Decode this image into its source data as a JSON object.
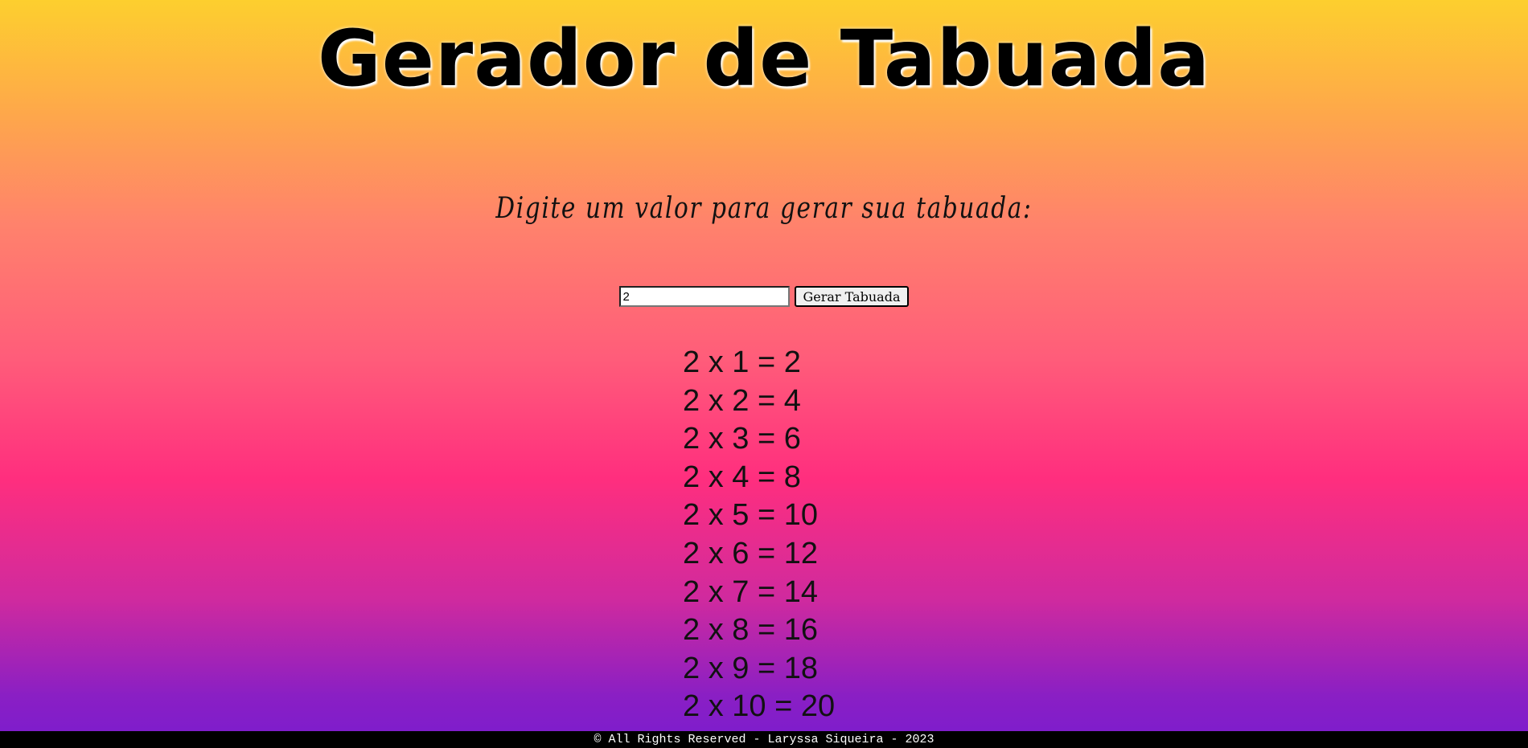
{
  "header": {
    "title": "Gerador de Tabuada"
  },
  "main": {
    "prompt": "Digite um valor para gerar sua tabuada:",
    "input_value": "2",
    "button_label": "Gerar Tabuada",
    "results": [
      "2 x 1 = 2",
      "2 x 2 = 4",
      "2 x 3 = 6",
      "2 x 4 = 8",
      "2 x 5 = 10",
      "2 x 6 = 12",
      "2 x 7 = 14",
      "2 x 8 = 16",
      "2 x 9 = 18",
      "2 x 10 = 20"
    ]
  },
  "footer": {
    "text": "© All Rights Reserved - Laryssa Siqueira - 2023"
  },
  "colors": {
    "gradient_top": "#fdcf2e",
    "gradient_middle": "#ff2e7e",
    "gradient_bottom": "#7a1ccf",
    "footer_background": "#000000"
  }
}
